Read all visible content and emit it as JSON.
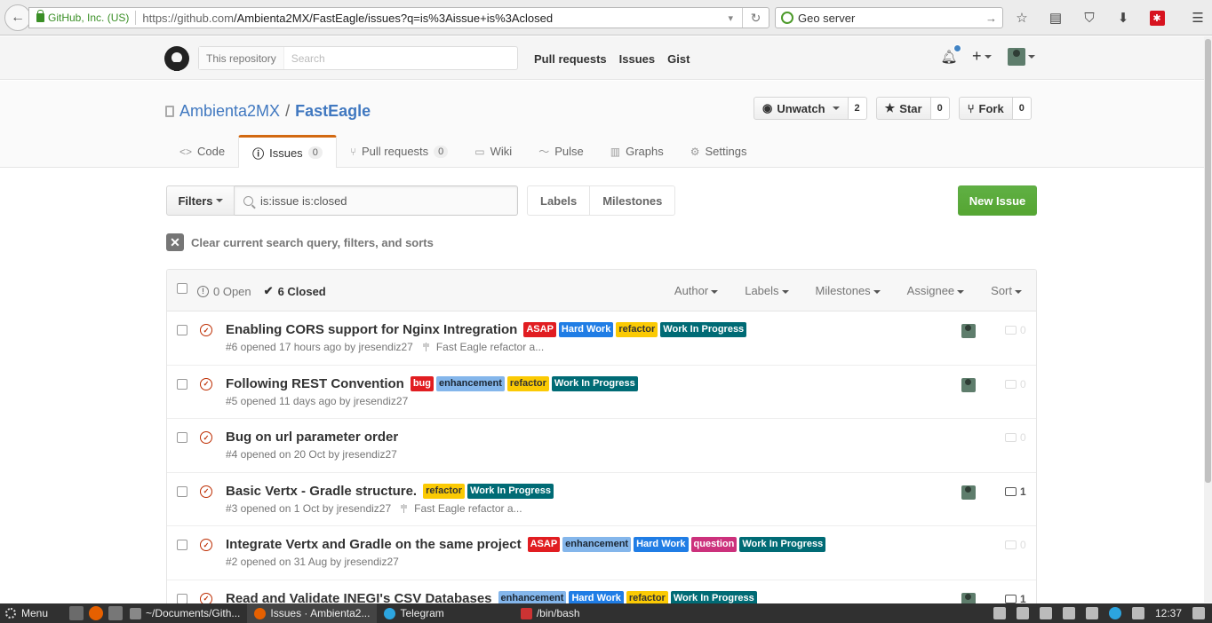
{
  "browser": {
    "site_identity": "GitHub, Inc. (US)",
    "url_prefix": "https://github.com",
    "url_path": "/Ambienta2MX/FastEagle/issues?q=is%3Aissue+is%3Aclosed",
    "search_value": "Geo server"
  },
  "header": {
    "scope_label": "This repository",
    "search_placeholder": "Search",
    "nav": [
      "Pull requests",
      "Issues",
      "Gist"
    ]
  },
  "repo": {
    "owner": "Ambienta2MX",
    "separator": "/",
    "name": "FastEagle",
    "watch_label": "Unwatch",
    "watch_count": "2",
    "star_label": "Star",
    "star_count": "0",
    "fork_label": "Fork",
    "fork_count": "0",
    "tabs": [
      {
        "label": "Code"
      },
      {
        "label": "Issues",
        "count": "0"
      },
      {
        "label": "Pull requests",
        "count": "0"
      },
      {
        "label": "Wiki"
      },
      {
        "label": "Pulse"
      },
      {
        "label": "Graphs"
      },
      {
        "label": "Settings"
      }
    ]
  },
  "filters": {
    "filters_label": "Filters",
    "query": "is:issue is:closed",
    "labels_link": "Labels",
    "milestones_link": "Milestones",
    "new_issue": "New Issue",
    "clear_text": "Clear current search query, filters, and sorts"
  },
  "table": {
    "open_count": "0 Open",
    "closed_count": "6 Closed",
    "columns": [
      "Author",
      "Labels",
      "Milestones",
      "Assignee",
      "Sort"
    ]
  },
  "issues": [
    {
      "title": "Enabling CORS support for Nginx Intregration",
      "meta": "#6 opened 17 hours ago by jresendiz27",
      "milestone": "Fast Eagle refactor a...",
      "comments": "0"
    },
    {
      "title": "Following REST Convention",
      "meta": "#5 opened 11 days ago by jresendiz27",
      "milestone": "",
      "comments": "0"
    },
    {
      "title": "Bug on url parameter order",
      "meta": "#4 opened on 20 Oct by jresendiz27",
      "milestone": "",
      "comments": "0"
    },
    {
      "title": "Basic Vertx - Gradle structure.",
      "meta": "#3 opened on 1 Oct by jresendiz27",
      "milestone": "Fast Eagle refactor a...",
      "comments": "1"
    },
    {
      "title": "Integrate Vertx and Gradle on the same project",
      "meta": "#2 opened on 31 Aug by jresendiz27",
      "milestone": "",
      "comments": "0"
    },
    {
      "title": "Read and Validate INEGI's CSV Databases",
      "meta": "",
      "milestone": "",
      "comments": "1"
    }
  ],
  "labels": {
    "asap": "ASAP",
    "hard_work": "Hard Work",
    "refactor": "refactor",
    "wip": "Work In Progress",
    "bug": "bug",
    "enhancement": "enhancement",
    "question": "question"
  },
  "label_colors": {
    "asap": "#e11d21",
    "hard_work": "#207de5",
    "refactor": "#fbca04",
    "wip": "#006b75",
    "bug": "#e11d21",
    "enhancement": "#84b6eb",
    "question": "#cc317c"
  },
  "taskbar": {
    "menu": "Menu",
    "tasks": [
      "~/Documents/Gith...",
      "Issues · Ambienta2...",
      "Telegram",
      "/bin/bash"
    ],
    "clock": "12:37"
  }
}
